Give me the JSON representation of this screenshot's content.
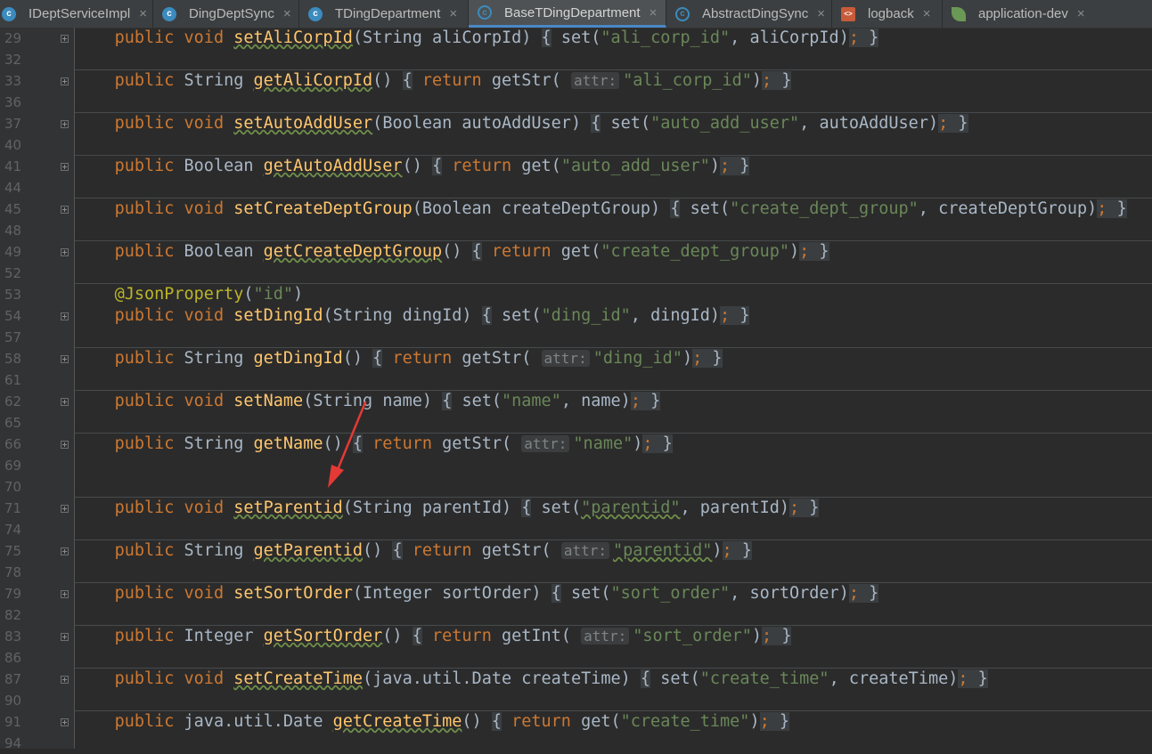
{
  "tabs": [
    {
      "label": "IDeptServiceImpl",
      "icon": "class-icon",
      "icon_text": "c"
    },
    {
      "label": "DingDeptSync",
      "icon": "class-icon",
      "icon_text": "c"
    },
    {
      "label": "TDingDepartment",
      "icon": "class-icon",
      "icon_text": "c"
    },
    {
      "label": "BaseTDingDepartment",
      "icon": "abstract-class-icon",
      "icon_text": "c"
    },
    {
      "label": "AbstractDingSync",
      "icon": "abstract-class-icon",
      "icon_text": "c"
    },
    {
      "label": "logback",
      "icon": "xml-file-icon",
      "icon_text": "<>"
    },
    {
      "label": "application-dev",
      "icon": "spring-leaf-icon",
      "icon_text": ""
    }
  ],
  "close_glyph": "×",
  "line_numbers": [
    "29",
    "32",
    "33",
    "36",
    "37",
    "40",
    "41",
    "44",
    "45",
    "48",
    "49",
    "52",
    "53",
    "54",
    "57",
    "58",
    "61",
    "62",
    "65",
    "66",
    "69",
    "70",
    "71",
    "74",
    "75",
    "78",
    "79",
    "82",
    "83",
    "86",
    "87",
    "90",
    "91",
    "94"
  ],
  "code": {
    "kw_public": "public",
    "kw_void": "void",
    "kw_return": "return",
    "t_String": "String",
    "t_Boolean": "Boolean",
    "t_Integer": "Integer",
    "t_Date": "java.util.Date",
    "attr_hint": "attr:",
    "annotation": "@JsonProperty",
    "annotation_arg": "\"id\"",
    "methods": {
      "setAliCorpId": "setAliCorpId",
      "getAliCorpId": "getAliCorpId",
      "setAutoAddUser": "setAutoAddUser",
      "getAutoAddUser": "getAutoAddUser",
      "setCreateDeptGroup": "setCreateDeptGroup",
      "getCreateDeptGroup": "getCreateDeptGroup",
      "setDingId": "setDingId",
      "getDingId": "getDingId",
      "setName": "setName",
      "getName": "getName",
      "setParentid": "setParentid",
      "getParentid": "getParentid",
      "setSortOrder": "setSortOrder",
      "getSortOrder": "getSortOrder",
      "setCreateTime": "setCreateTime",
      "getCreateTime": "getCreateTime"
    },
    "strings": {
      "ali_corp_id": "\"ali_corp_id\"",
      "auto_add_user": "\"auto_add_user\"",
      "create_dept_group": "\"create_dept_group\"",
      "ding_id": "\"ding_id\"",
      "name": "\"name\"",
      "parentid": "\"parentid\"",
      "sort_order": "\"sort_order\"",
      "create_time": "\"create_time\""
    },
    "params": {
      "aliCorpId": "aliCorpId",
      "autoAddUser": "autoAddUser",
      "createDeptGroup": "createDeptGroup",
      "dingId": "dingId",
      "name": "name",
      "parentId": "parentId",
      "sortOrder": "sortOrder",
      "createTime": "createTime"
    },
    "calls": {
      "set": "set",
      "get": "get",
      "getStr": "getStr",
      "getInt": "getInt"
    }
  },
  "colors": {
    "background": "#2b2b2b",
    "keyword": "#cc7832",
    "method": "#ffc66d",
    "string": "#6a8759",
    "annotation": "#bbb529",
    "arrow": "#e53935"
  }
}
